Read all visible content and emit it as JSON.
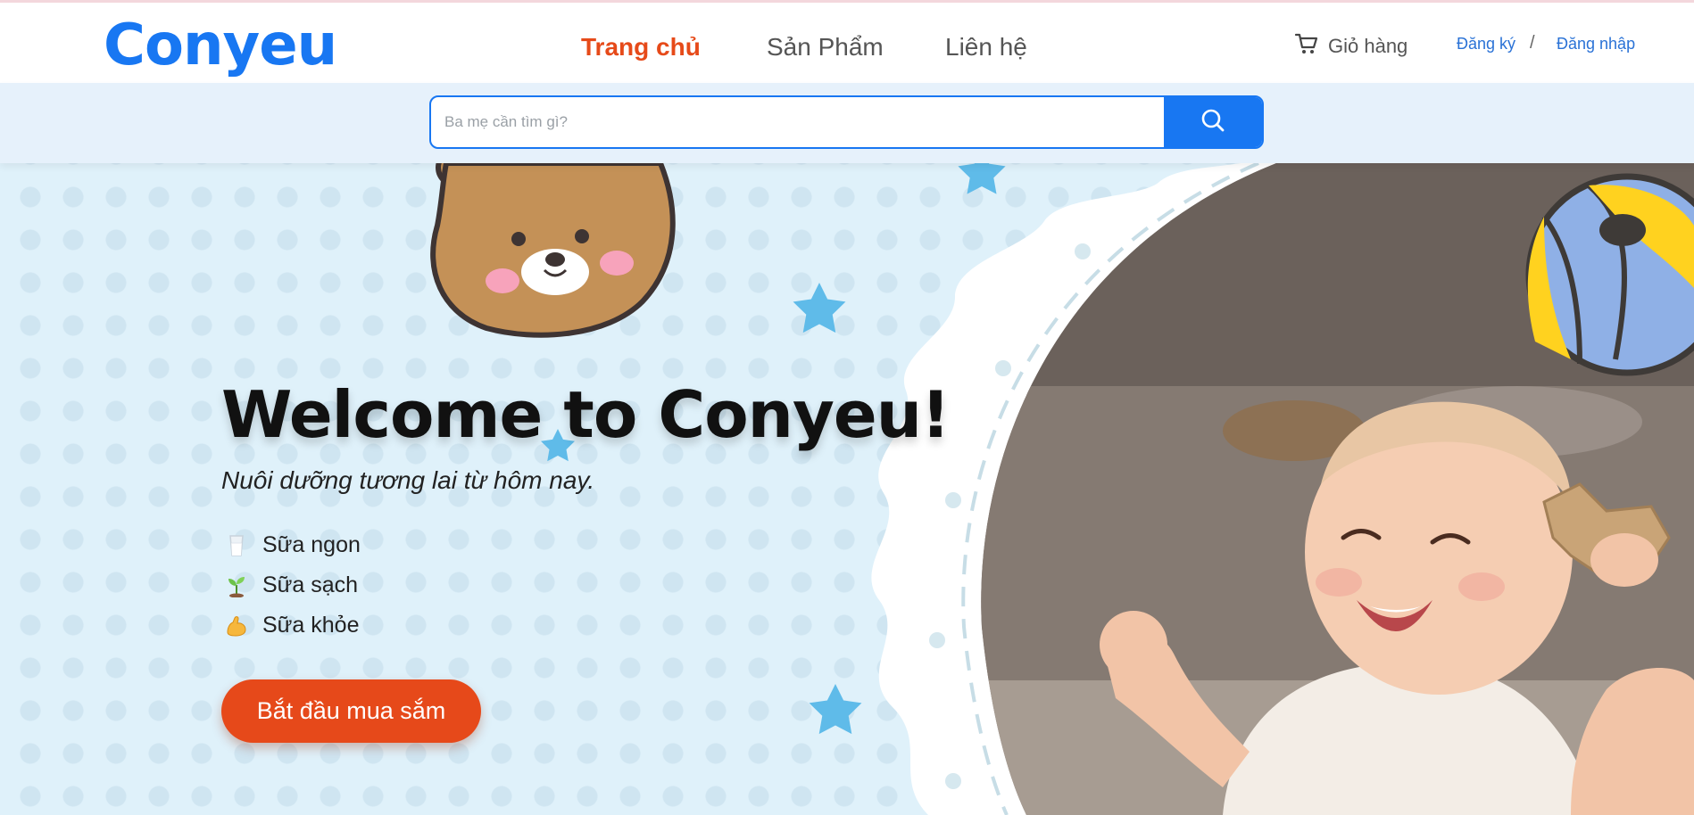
{
  "header": {
    "logo": "Conyeu",
    "nav": {
      "home": "Trang chủ",
      "products": "Sản Phẩm",
      "contact": "Liên hệ"
    },
    "active_nav": "home",
    "cart_label": "Giỏ hàng",
    "register_label": "Đăng ký",
    "separator": "/",
    "login_label": "Đăng nhập"
  },
  "search": {
    "placeholder": "Ba mẹ cần tìm gì?",
    "value": "",
    "button_icon": "search-icon"
  },
  "hero": {
    "title": "Welcome to Conyeu!",
    "subtitle": "Nuôi dưỡng tương lai từ hôm nay.",
    "features": [
      {
        "icon": "milk-glass-icon",
        "label": "Sữa ngon"
      },
      {
        "icon": "seedling-icon",
        "label": "Sữa sạch"
      },
      {
        "icon": "flexed-biceps-icon",
        "label": "Sữa khỏe"
      }
    ],
    "cta_label": "Bắt đầu mua sắm",
    "decorations": [
      "bear-icon",
      "star-icon",
      "ball-icon"
    ],
    "image": "laughing-baby-photo"
  },
  "colors": {
    "brand": "#1877f2",
    "accent": "#e6491a",
    "nav_active": "#e64a19",
    "hero_bg": "#dff1fa",
    "search_band": "#e6f1fb"
  }
}
